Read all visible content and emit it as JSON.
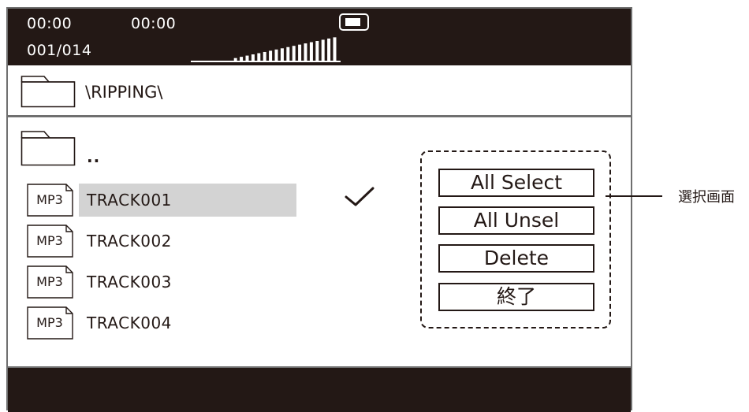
{
  "status": {
    "elapsed_time": "00:00",
    "total_time": "00:00",
    "track_counter": "001/014",
    "volume_level": 1.0
  },
  "path": {
    "current": "\\RIPPING\\"
  },
  "list": {
    "parent_label": "..",
    "items": [
      {
        "type": "MP3",
        "name": "TRACK001",
        "selected": true,
        "checked": true
      },
      {
        "type": "MP3",
        "name": "TRACK002",
        "selected": false,
        "checked": false
      },
      {
        "type": "MP3",
        "name": "TRACK003",
        "selected": false,
        "checked": false
      },
      {
        "type": "MP3",
        "name": "TRACK004",
        "selected": false,
        "checked": false
      }
    ]
  },
  "menu": {
    "all_select": "All  Select",
    "all_unsel": "All  Unsel",
    "delete": "Delete",
    "exit": "終了"
  },
  "annotation": {
    "label": "選択画面"
  },
  "icons": {
    "folder": "folder-icon",
    "file": "mp3-file-icon",
    "battery": "battery-icon",
    "volume": "volume-meter-icon",
    "check": "check-icon"
  },
  "colors": {
    "bar": "#231815",
    "highlight": "#d3d3d3",
    "frame": "#6f6f6f"
  }
}
